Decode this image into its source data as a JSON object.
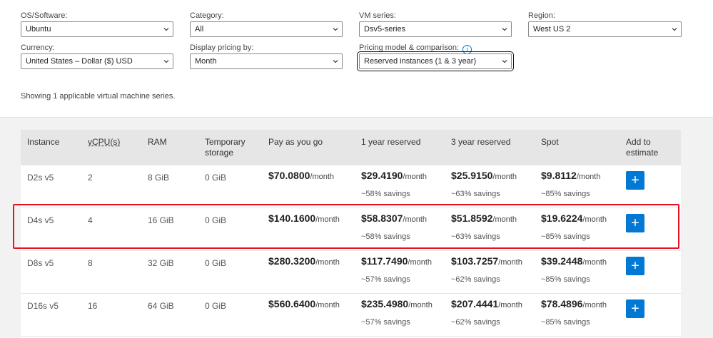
{
  "filters": {
    "os": {
      "label": "OS/Software:",
      "value": "Ubuntu"
    },
    "category": {
      "label": "Category:",
      "value": "All"
    },
    "vm_series": {
      "label": "VM series:",
      "value": "Dsv5-series"
    },
    "region": {
      "label": "Region:",
      "value": "West US 2"
    },
    "currency": {
      "label": "Currency:",
      "value": "United States – Dollar ($) USD"
    },
    "display_pricing": {
      "label": "Display pricing by:",
      "value": "Month"
    },
    "pricing_model": {
      "label": "Pricing model & comparison:",
      "value": "Reserved instances (1 & 3 year)",
      "info_icon": "i"
    }
  },
  "showing_text": "Showing 1 applicable virtual machine series.",
  "table": {
    "headers": {
      "instance": "Instance",
      "vcpu": "vCPU(s)",
      "ram": "RAM",
      "temp1": "Temporary",
      "temp2": "storage",
      "payg": "Pay as you go",
      "yr1": "1 year reserved",
      "yr3": "3 year reserved",
      "spot": "Spot",
      "add1": "Add to",
      "add2": "estimate"
    },
    "per_month": "/month",
    "add_button_glyph": "+",
    "rows": [
      {
        "instance": "D2s v5",
        "vcpu": "2",
        "ram": "8 GiB",
        "storage": "0 GiB",
        "payg": "$70.0800",
        "yr1": "$29.4190",
        "yr1_sav": "~58% savings",
        "yr3": "$25.9150",
        "yr3_sav": "~63% savings",
        "spot": "$9.8112",
        "spot_sav": "~85% savings"
      },
      {
        "instance": "D4s v5",
        "vcpu": "4",
        "ram": "16 GiB",
        "storage": "0 GiB",
        "payg": "$140.1600",
        "yr1": "$58.8307",
        "yr1_sav": "~58% savings",
        "yr3": "$51.8592",
        "yr3_sav": "~63% savings",
        "spot": "$19.6224",
        "spot_sav": "~85% savings"
      },
      {
        "instance": "D8s v5",
        "vcpu": "8",
        "ram": "32 GiB",
        "storage": "0 GiB",
        "payg": "$280.3200",
        "yr1": "$117.7490",
        "yr1_sav": "~57% savings",
        "yr3": "$103.7257",
        "yr3_sav": "~62% savings",
        "spot": "$39.2448",
        "spot_sav": "~85% savings"
      },
      {
        "instance": "D16s v5",
        "vcpu": "16",
        "ram": "64 GiB",
        "storage": "0 GiB",
        "payg": "$560.6400",
        "yr1": "$235.4980",
        "yr1_sav": "~57% savings",
        "yr3": "$207.4441",
        "yr3_sav": "~62% savings",
        "spot": "$78.4896",
        "spot_sav": "~85% savings"
      }
    ]
  },
  "colors": {
    "accent": "#0078d4",
    "highlight": "#e81123",
    "header_bg": "#e6e6e6"
  }
}
